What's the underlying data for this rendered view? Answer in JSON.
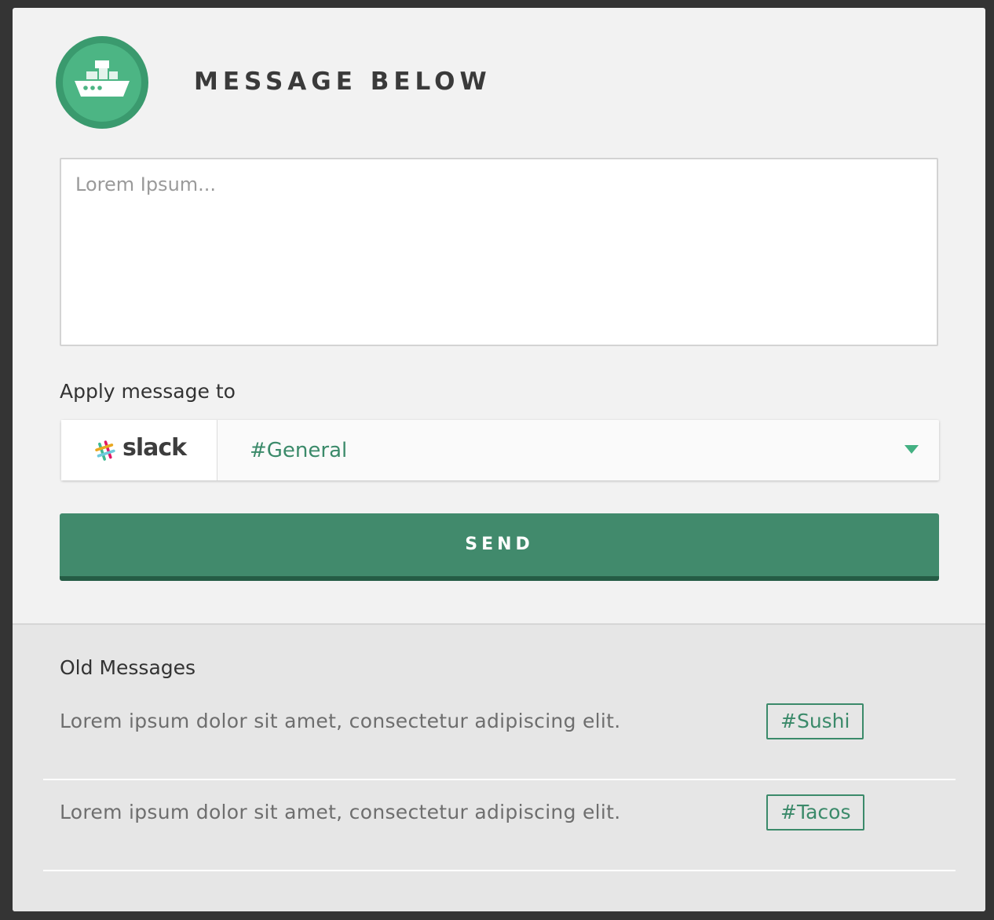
{
  "header": {
    "logo_icon": "ship-icon",
    "title": "MESSAGE BELOW"
  },
  "composer": {
    "placeholder": "Lorem Ipsum...",
    "value": ""
  },
  "apply": {
    "label": "Apply message to",
    "service_icon": "slack-logo-icon",
    "service_name": "slack",
    "selected_channel": "#General",
    "dropdown_icon": "caret-down-icon"
  },
  "send": {
    "label": "SEND"
  },
  "old_messages": {
    "title": "Old Messages",
    "items": [
      {
        "text": "Lorem ipsum dolor sit amet, consectetur adipiscing elit.",
        "tag": "#Sushi"
      },
      {
        "text": "Lorem ipsum dolor sit amet, consectetur adipiscing elit.",
        "tag": "#Tacos"
      }
    ]
  },
  "colors": {
    "accent": "#418a6c",
    "accent_dark": "#255c45",
    "logo_outer": "#3a9a6e",
    "logo_inner": "#4cb584",
    "tag_text": "#3b8a6a",
    "dropdown_caret": "#43b082"
  }
}
